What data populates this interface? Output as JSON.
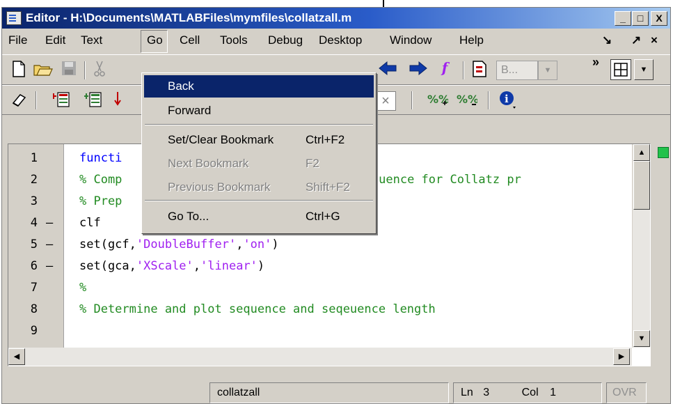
{
  "window": {
    "title": "Editor - H:\\Documents\\MATLABFiles\\mymfiles\\collatzall.m",
    "buttons": {
      "minimize": "_",
      "maximize": "□",
      "close": "X"
    }
  },
  "menubar": {
    "items": [
      "File",
      "Edit",
      "Text",
      "Go",
      "Cell",
      "Tools",
      "Debug",
      "Desktop",
      "Window",
      "Help"
    ],
    "right_controls": [
      "↘",
      "↗",
      "×"
    ]
  },
  "toolbar": {
    "stack_select": "B...",
    "stack_arrow": "▼",
    "more": "»",
    "layout_arrow": "▼",
    "function_icon": "f",
    "close_x": "×"
  },
  "go_menu": {
    "items": [
      {
        "label": "Back",
        "shortcut": "",
        "selected": true,
        "enabled": true
      },
      {
        "label": "Forward",
        "shortcut": "",
        "selected": false,
        "enabled": true
      },
      {
        "label": "Set/Clear Bookmark",
        "shortcut": "Ctrl+F2",
        "selected": false,
        "enabled": true
      },
      {
        "label": "Next Bookmark",
        "shortcut": "F2",
        "selected": false,
        "enabled": false
      },
      {
        "label": "Previous Bookmark",
        "shortcut": "Shift+F2",
        "selected": false,
        "enabled": false
      },
      {
        "label": "Go To...",
        "shortcut": "Ctrl+G",
        "selected": false,
        "enabled": true
      }
    ]
  },
  "editor": {
    "lines": [
      {
        "num": "1",
        "bp": "",
        "parts": [
          {
            "t": "functi",
            "c": "kw"
          }
        ]
      },
      {
        "num": "2",
        "bp": "",
        "parts": [
          {
            "t": "% Comp",
            "c": "cmt"
          },
          {
            "t": "sequence for Collatz pr",
            "c": "cmt",
            "gap": true
          }
        ]
      },
      {
        "num": "3",
        "bp": "",
        "parts": [
          {
            "t": "% Prep",
            "c": "cmt"
          }
        ]
      },
      {
        "num": "4",
        "bp": "–",
        "parts": [
          {
            "t": "clf",
            "c": ""
          }
        ]
      },
      {
        "num": "5",
        "bp": "–",
        "parts": [
          {
            "t": "set(gcf,",
            "c": ""
          },
          {
            "t": "'DoubleBuffer'",
            "c": "str"
          },
          {
            "t": ",",
            "c": ""
          },
          {
            "t": "'on'",
            "c": "str"
          },
          {
            "t": ")",
            "c": ""
          }
        ]
      },
      {
        "num": "6",
        "bp": "–",
        "parts": [
          {
            "t": "set(gca,",
            "c": ""
          },
          {
            "t": "'XScale'",
            "c": "str"
          },
          {
            "t": ",",
            "c": ""
          },
          {
            "t": "'linear'",
            "c": "str"
          },
          {
            "t": ")",
            "c": ""
          }
        ]
      },
      {
        "num": "7",
        "bp": "",
        "parts": [
          {
            "t": "%",
            "c": "cmt"
          }
        ]
      },
      {
        "num": "8",
        "bp": "",
        "parts": [
          {
            "t": "% Determine and plot sequence and seqeuence length",
            "c": "cmt"
          }
        ]
      },
      {
        "num": "9",
        "bp": "",
        "parts": []
      }
    ]
  },
  "statusbar": {
    "function_name": "collatzall",
    "ln_label": "Ln",
    "ln_value": "3",
    "col_label": "Col",
    "col_value": "1",
    "mode": "OVR"
  },
  "colors": {
    "title_start": "#0a246a",
    "title_end": "#a6caf0",
    "menu_selection": "#0a246a",
    "comment": "#228b22",
    "string": "#a020f0",
    "keyword": "#0000ff",
    "chrome": "#d4d0c8"
  }
}
